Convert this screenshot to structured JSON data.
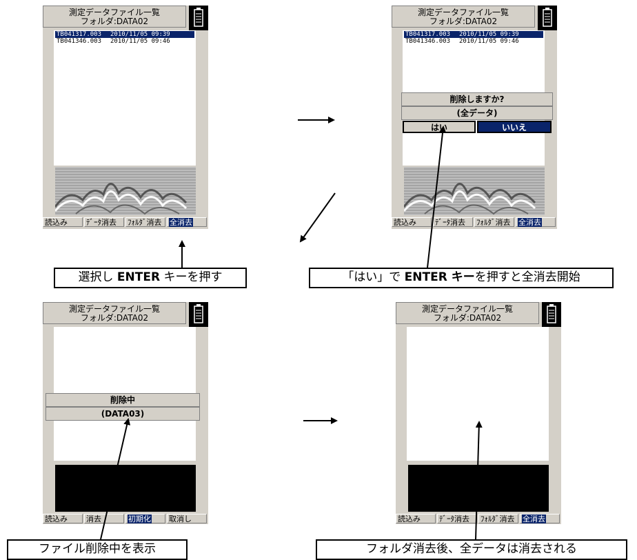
{
  "title": "測定データファイル一覧",
  "folder": "フォルダ:DATA02",
  "files": [
    {
      "name": "TB041317.003",
      "date": "2010/11/05 09:39"
    },
    {
      "name": "TB041346.003",
      "date": "2010/11/05 09:46"
    }
  ],
  "softkeys_main": [
    "読込み",
    "ﾃﾞｰﾀ消去",
    "ﾌｫﾙﾀﾞ消去",
    "全消去"
  ],
  "softkeys_deleting": [
    "読込み",
    "消去",
    "初期化",
    "取消し"
  ],
  "confirm_dialog": {
    "question": "削除しますか?",
    "target": "(全データ)",
    "yes": "はい",
    "no": "いいえ"
  },
  "progress_dialog": {
    "status": "削除中",
    "target": "(DATA03)"
  },
  "callouts": {
    "select": [
      "選択し ",
      "ENTER",
      " キーを押す"
    ],
    "yes": [
      "「はい」で ",
      "ENTER キー",
      "を押すと全消去開始"
    ],
    "progress": "ファイル削除中を表示",
    "done": "フォルダ消去後、全データは消去される"
  },
  "colors": {
    "panel": "#d4d0c8",
    "highlight": "#0a246a"
  }
}
